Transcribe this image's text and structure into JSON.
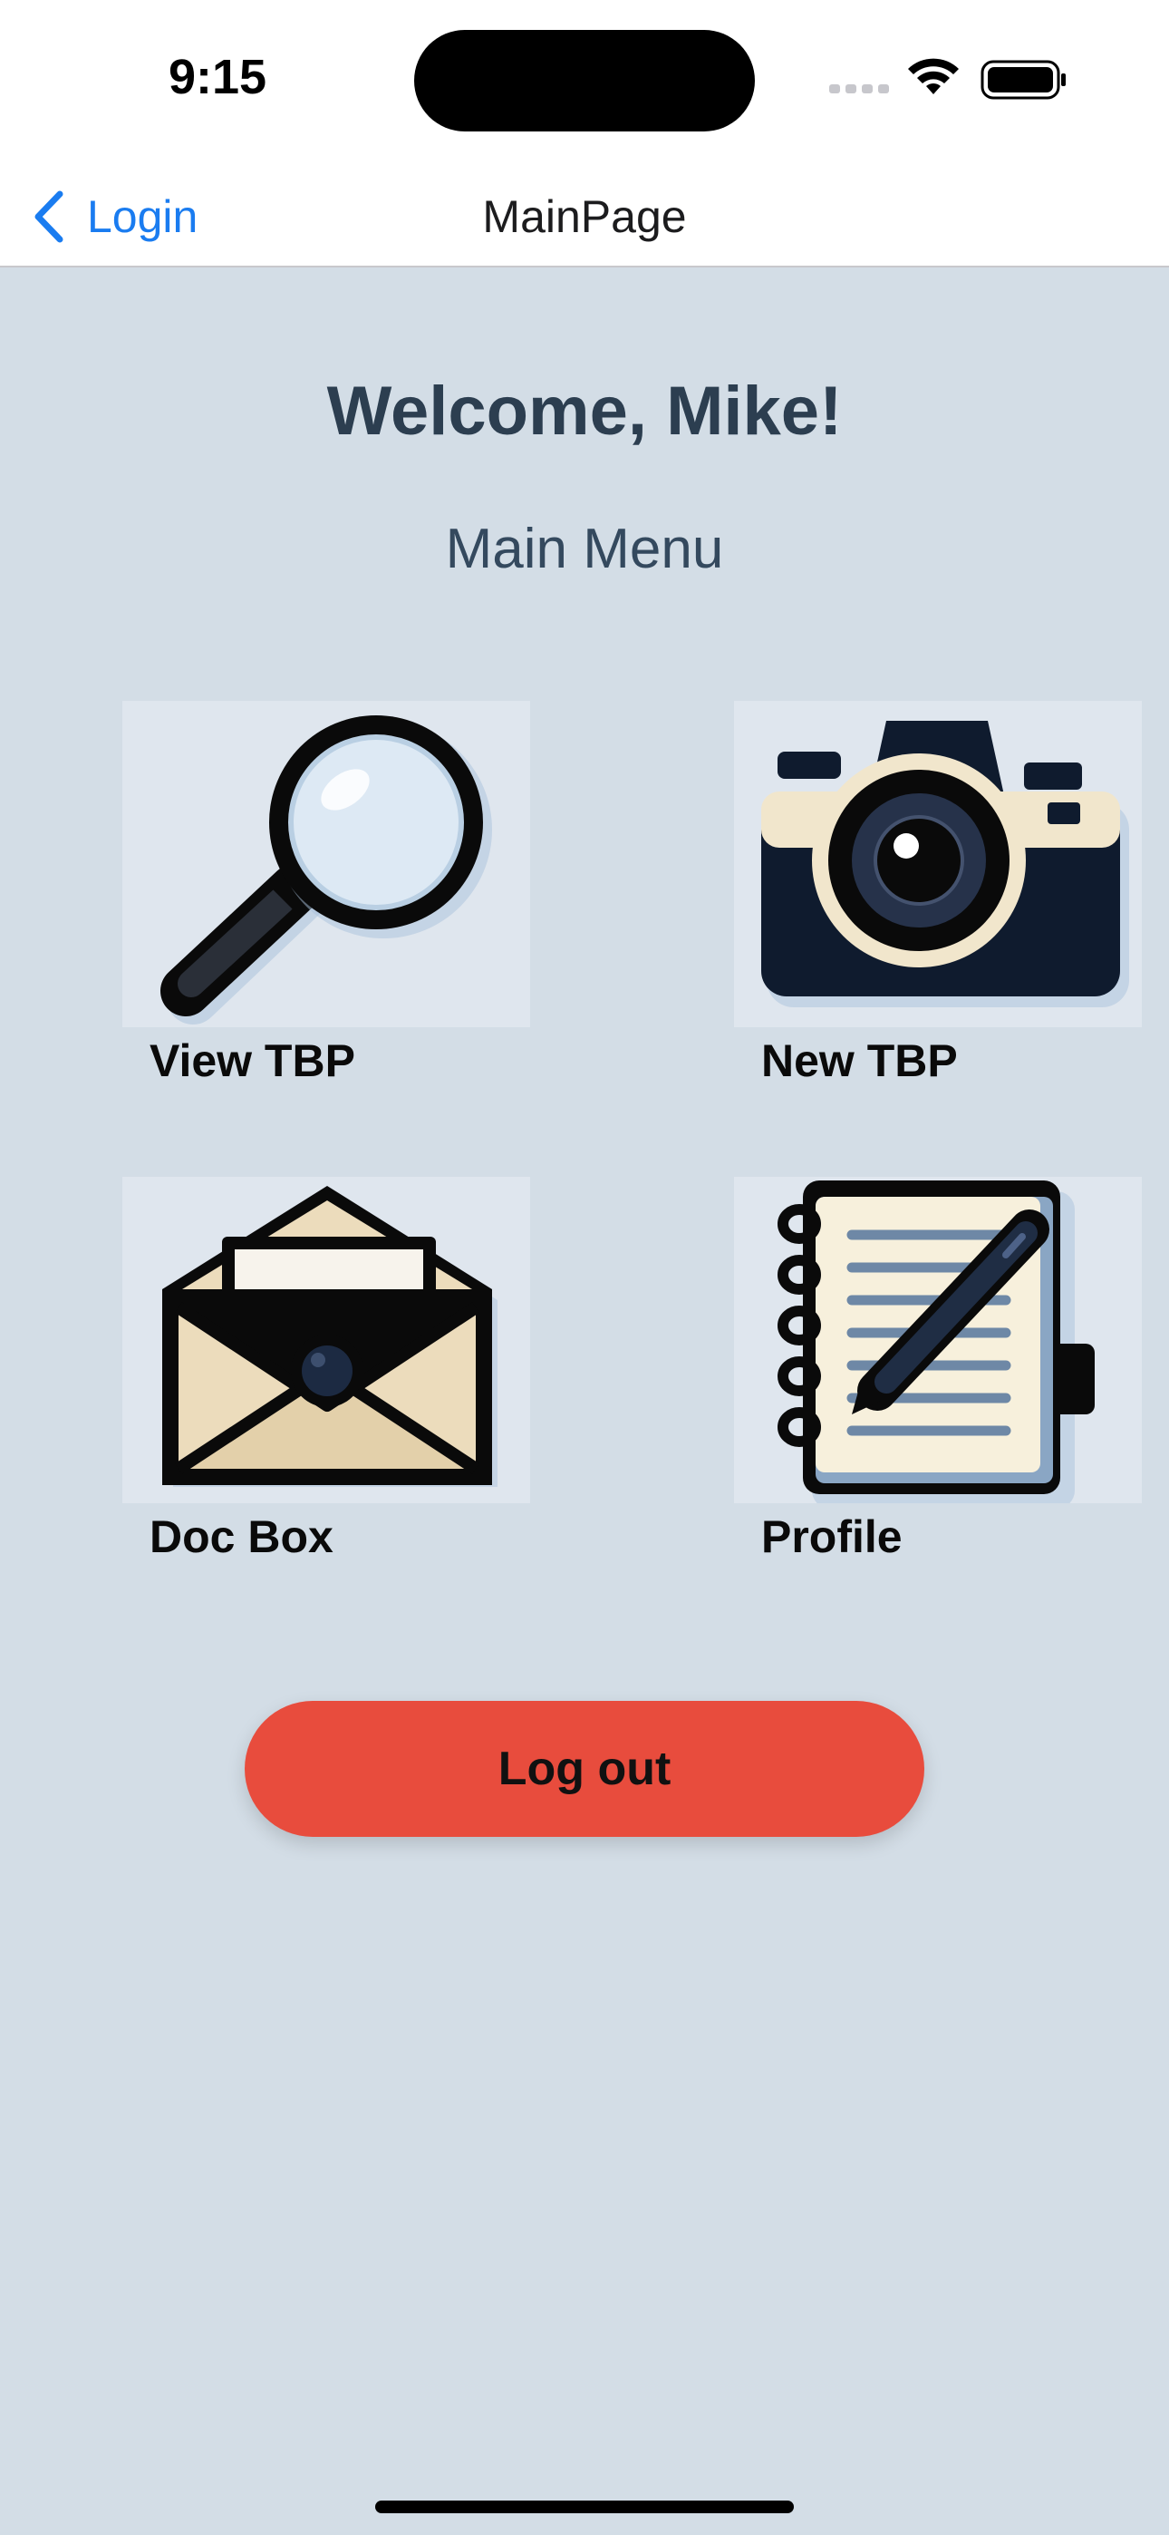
{
  "status_bar": {
    "time": "9:15"
  },
  "nav": {
    "back_label": "Login",
    "title": "MainPage"
  },
  "main": {
    "welcome": "Welcome, Mike!",
    "menu_title": "Main Menu",
    "tiles": [
      {
        "label": "View TBP",
        "icon": "magnifying-glass-icon"
      },
      {
        "label": "New TBP",
        "icon": "camera-icon"
      },
      {
        "label": "Doc Box",
        "icon": "envelope-icon"
      },
      {
        "label": "Profile",
        "icon": "notebook-icon"
      }
    ]
  },
  "logout_label": "Log out",
  "colors": {
    "background": "#d3dde6",
    "accent": "#1a7cf0",
    "logout": "#e84c3d",
    "heading": "#2c3e50"
  }
}
